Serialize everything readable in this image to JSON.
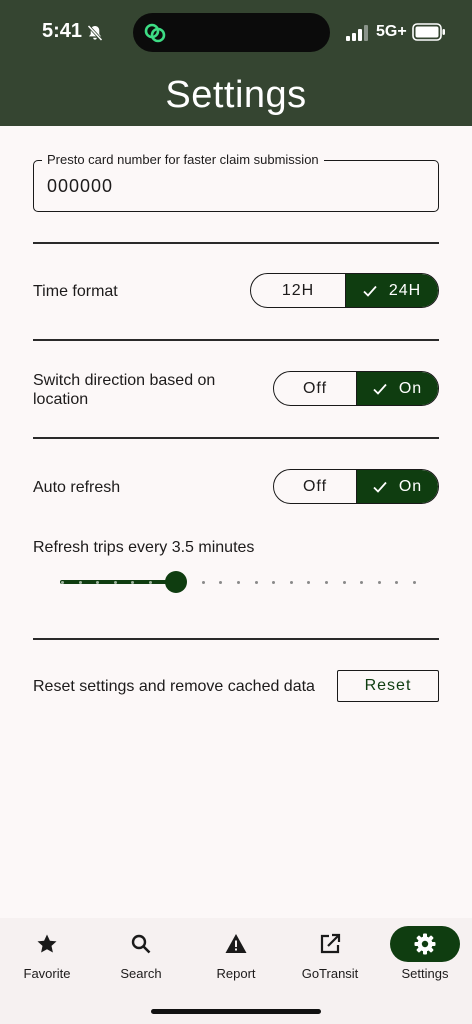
{
  "status_bar": {
    "time": "5:41",
    "network": "5G+"
  },
  "header": {
    "title": "Settings"
  },
  "presto": {
    "label": "Presto card number for faster claim submission",
    "value": "000000"
  },
  "time_format": {
    "label": "Time format",
    "options": [
      "12H",
      "24H"
    ],
    "selected": "24H"
  },
  "switch_direction": {
    "label": "Switch direction based on location",
    "options": [
      "Off",
      "On"
    ],
    "selected": "On"
  },
  "auto_refresh": {
    "label": "Auto refresh",
    "options": [
      "Off",
      "On"
    ],
    "selected": "On"
  },
  "refresh_interval": {
    "label": "Refresh trips every 3.5 minutes",
    "value": 3.5,
    "position_fraction": 0.32,
    "steps": 20
  },
  "reset": {
    "label": "Reset settings and remove cached data",
    "button": "Reset"
  },
  "colors": {
    "header_bg": "#354531",
    "accent": "#0f3d10",
    "background": "#fcf8f8",
    "island_icon": "#3ddc84"
  },
  "bottom_nav": {
    "items": [
      {
        "label": "Favorite",
        "icon": "star-icon"
      },
      {
        "label": "Search",
        "icon": "search-icon"
      },
      {
        "label": "Report",
        "icon": "warning-icon"
      },
      {
        "label": "GoTransit",
        "icon": "open-external-icon"
      },
      {
        "label": "Settings",
        "icon": "gear-icon"
      }
    ],
    "active": "Settings"
  }
}
